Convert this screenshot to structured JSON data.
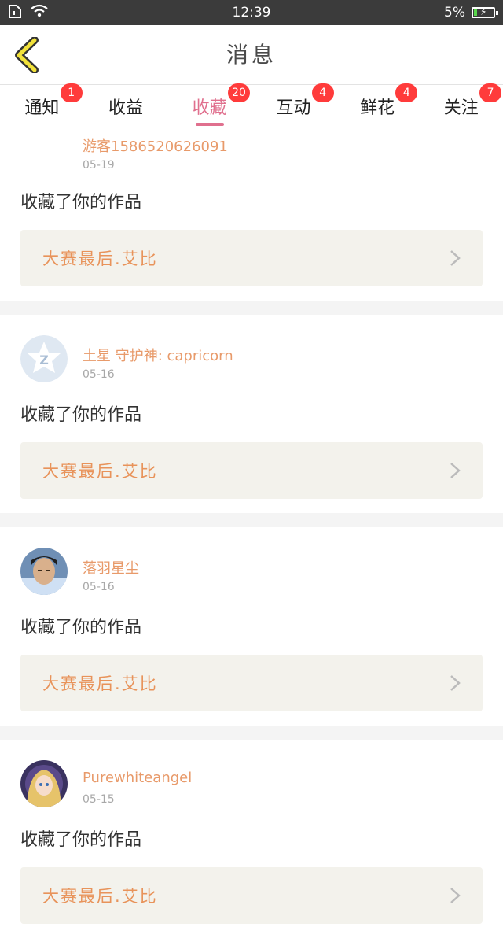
{
  "status_bar": {
    "time": "12:39",
    "battery": "5%",
    "icons": [
      "sim-icon",
      "wifi-icon",
      "battery-icon"
    ]
  },
  "header": {
    "title": "消息",
    "back_icon": "chevron-left-icon"
  },
  "tabs": [
    {
      "label": "通知",
      "badge": "1"
    },
    {
      "label": "收益",
      "badge": ""
    },
    {
      "label": "收藏",
      "badge": "20",
      "active": true
    },
    {
      "label": "互动",
      "badge": "4"
    },
    {
      "label": "鲜花",
      "badge": "4"
    },
    {
      "label": "关注",
      "badge": "7"
    }
  ],
  "feed": [
    {
      "username": "游客15865206260​91",
      "date": "05-19",
      "action": "收藏了你的作品",
      "work": "大赛最后.艾比",
      "avatar": "none"
    },
    {
      "username": "土星 守护神: capricorn",
      "date": "05-16",
      "action": "收藏了你的作品",
      "work": "大赛最后.艾比",
      "avatar": "qq-icon"
    },
    {
      "username": "落羽星尘",
      "date": "05-16",
      "action": "收藏了你的作品",
      "work": "大赛最后.艾比",
      "avatar": "photo"
    },
    {
      "username": "Purewhiteangel",
      "date": "05-15",
      "action": "收藏了你的作品",
      "work": "大赛最后.艾比",
      "avatar": "anime"
    }
  ],
  "colors": {
    "accent_pink": "#e0708e",
    "badge_red": "#ff3b3b",
    "username_orange": "#e89a6a",
    "work_orange": "#e8935a",
    "back_yellow": "#f2e23a"
  }
}
